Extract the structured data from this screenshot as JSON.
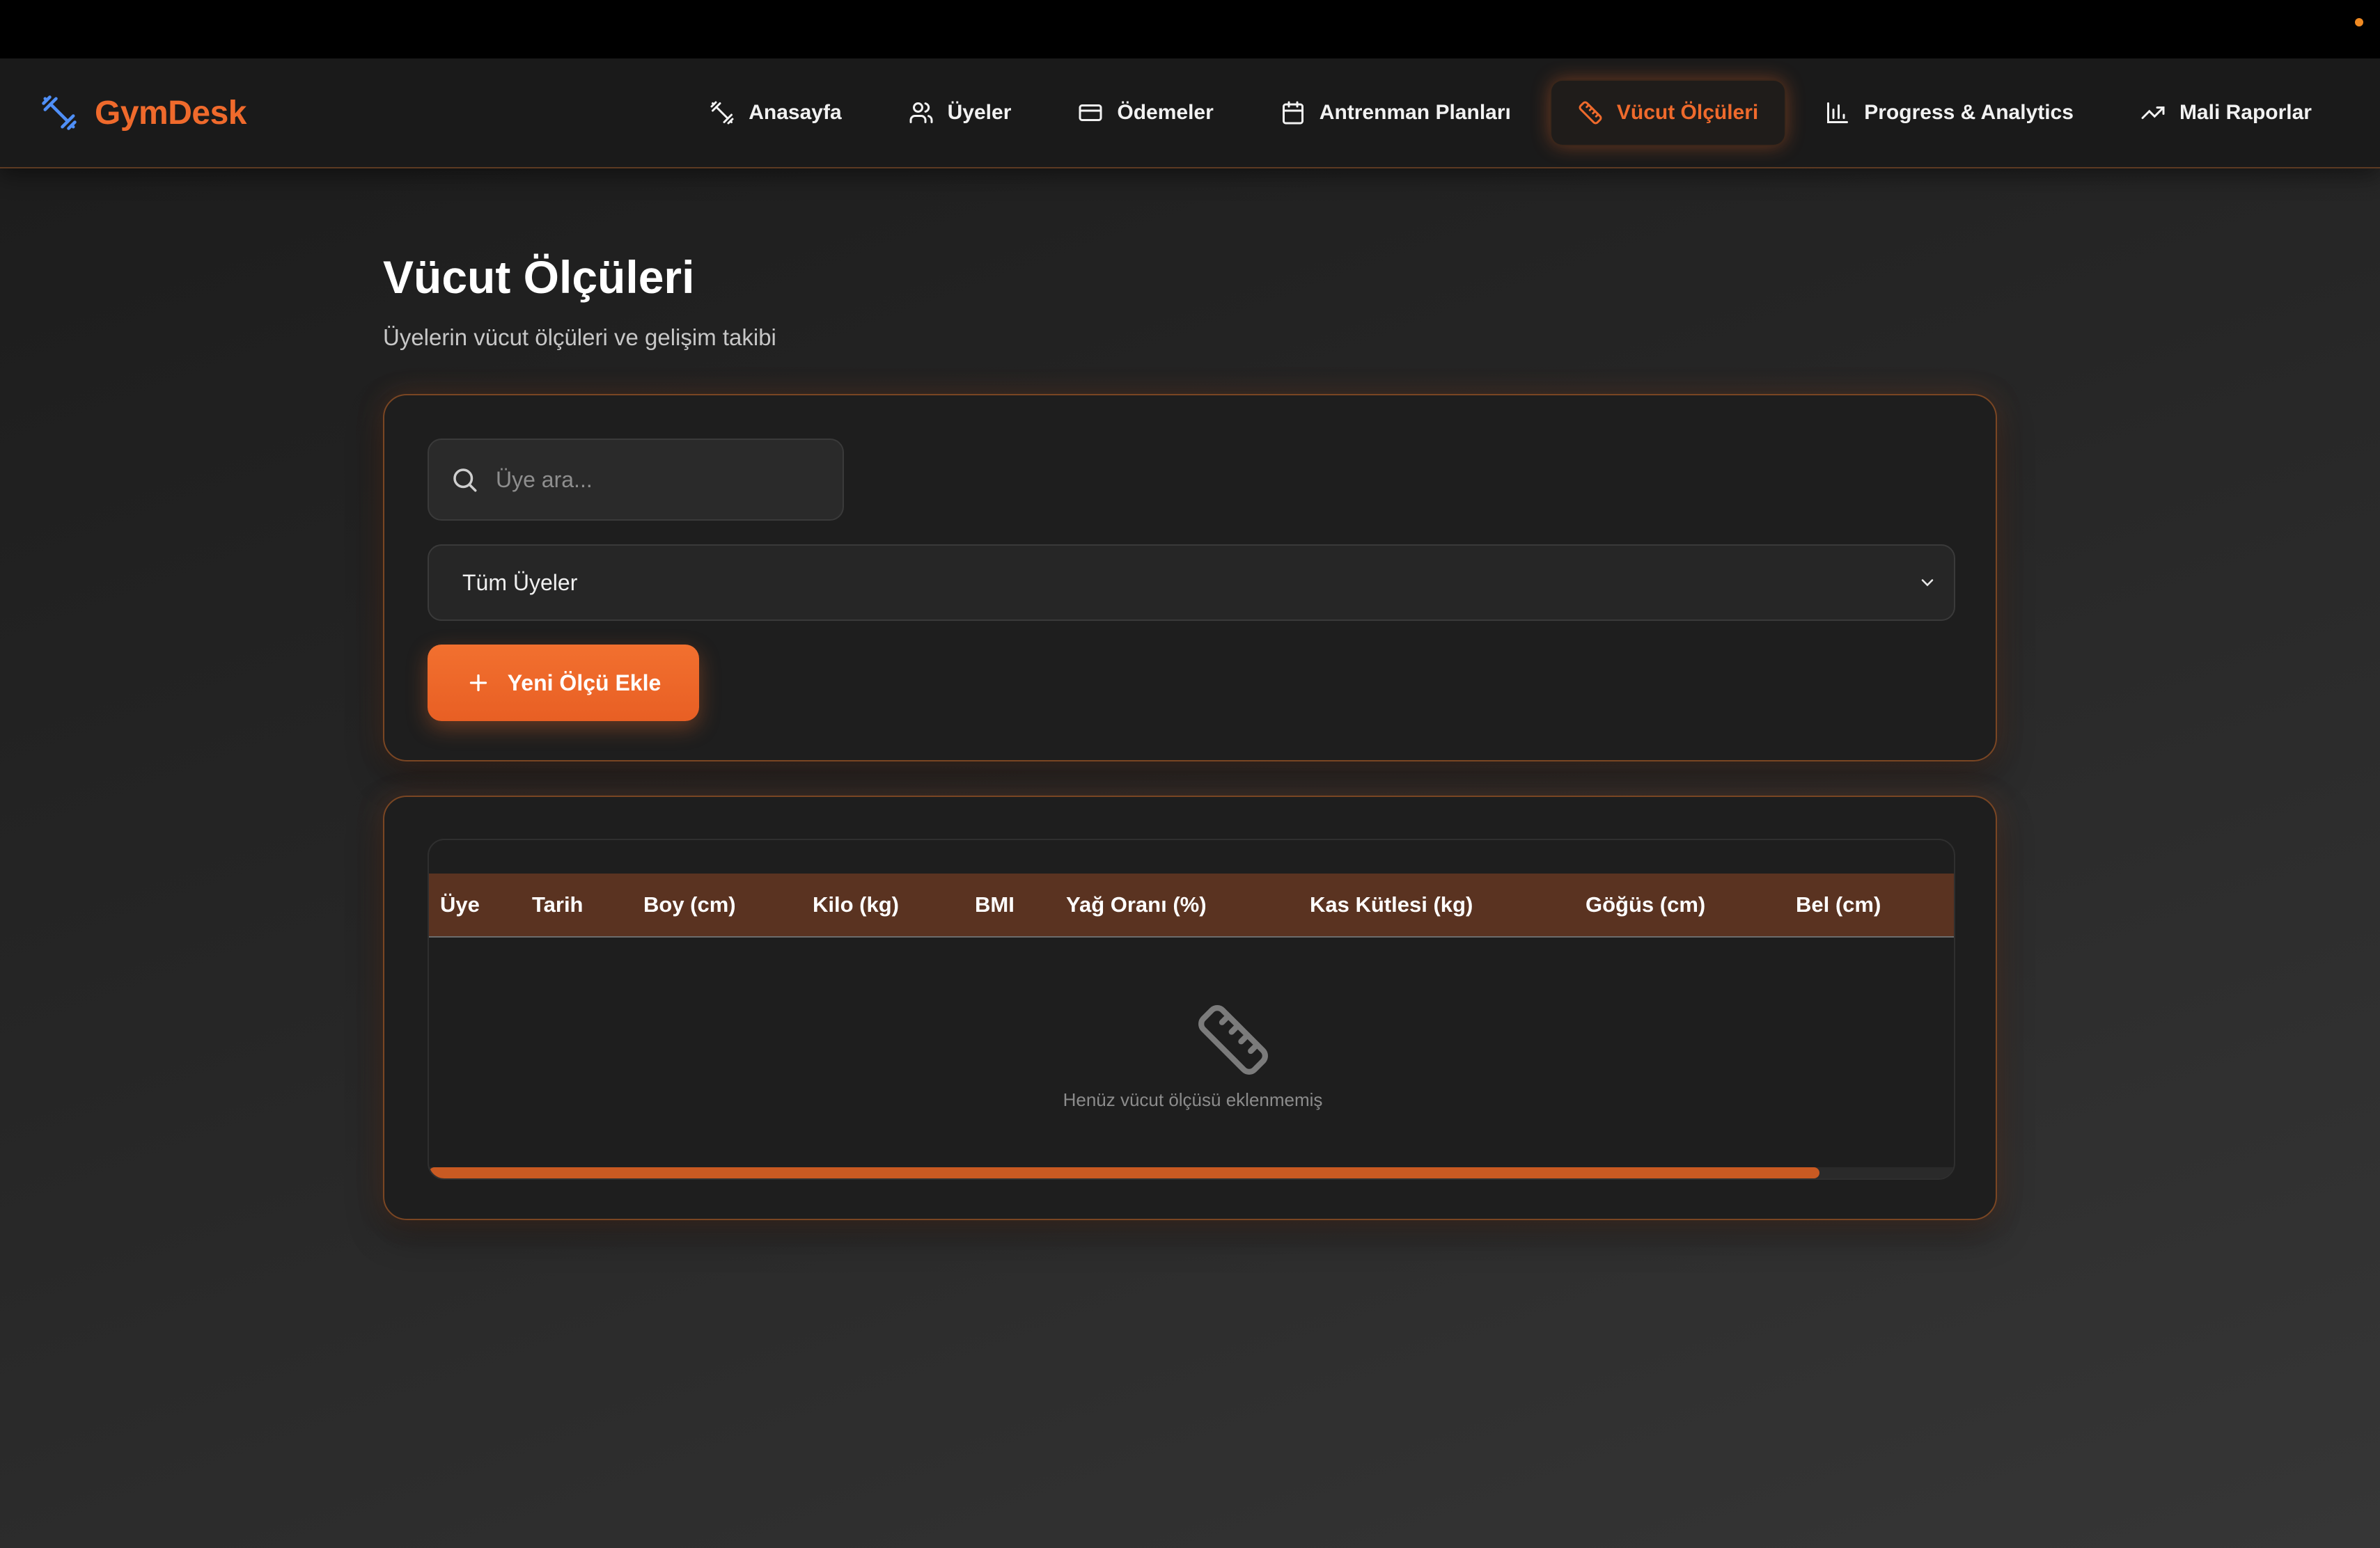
{
  "brand": {
    "name": "GymDesk",
    "icon": "dumbbell-icon",
    "icon_color": "#4f8ff7",
    "color": "#ef6a2c"
  },
  "nav": {
    "items": [
      {
        "label": "Anasayfa",
        "icon": "dumbbell-icon"
      },
      {
        "label": "Üyeler",
        "icon": "users-icon"
      },
      {
        "label": "Ödemeler",
        "icon": "credit-card-icon"
      },
      {
        "label": "Antrenman Planları",
        "icon": "calendar-icon"
      },
      {
        "label": "Vücut Ölçüleri",
        "icon": "ruler-icon",
        "active": true
      },
      {
        "label": "Progress & Analytics",
        "icon": "bar-chart-icon"
      },
      {
        "label": "Mali Raporlar",
        "icon": "trending-up-icon"
      }
    ]
  },
  "page": {
    "title": "Vücut Ölçüleri",
    "subtitle": "Üyelerin vücut ölçüleri ve gelişim takibi"
  },
  "filters": {
    "search_placeholder": "Üye ara...",
    "member_select_value": "Tüm Üyeler",
    "add_button_label": "Yeni Ölçü Ekle"
  },
  "table": {
    "columns": [
      "Üye",
      "Tarih",
      "Boy (cm)",
      "Kilo (kg)",
      "BMI",
      "Yağ Oranı (%)",
      "Kas Kütlesi (kg)",
      "Göğüs (cm)",
      "Bel (cm)"
    ],
    "rows": [],
    "empty_message": "Henüz vücut ölçüsü eklenmemiş",
    "scroll_fraction": 0.91
  },
  "colors": {
    "accent": "#ef6a2c",
    "header_bg": "#5a3321",
    "background": "#1e1e1e"
  }
}
